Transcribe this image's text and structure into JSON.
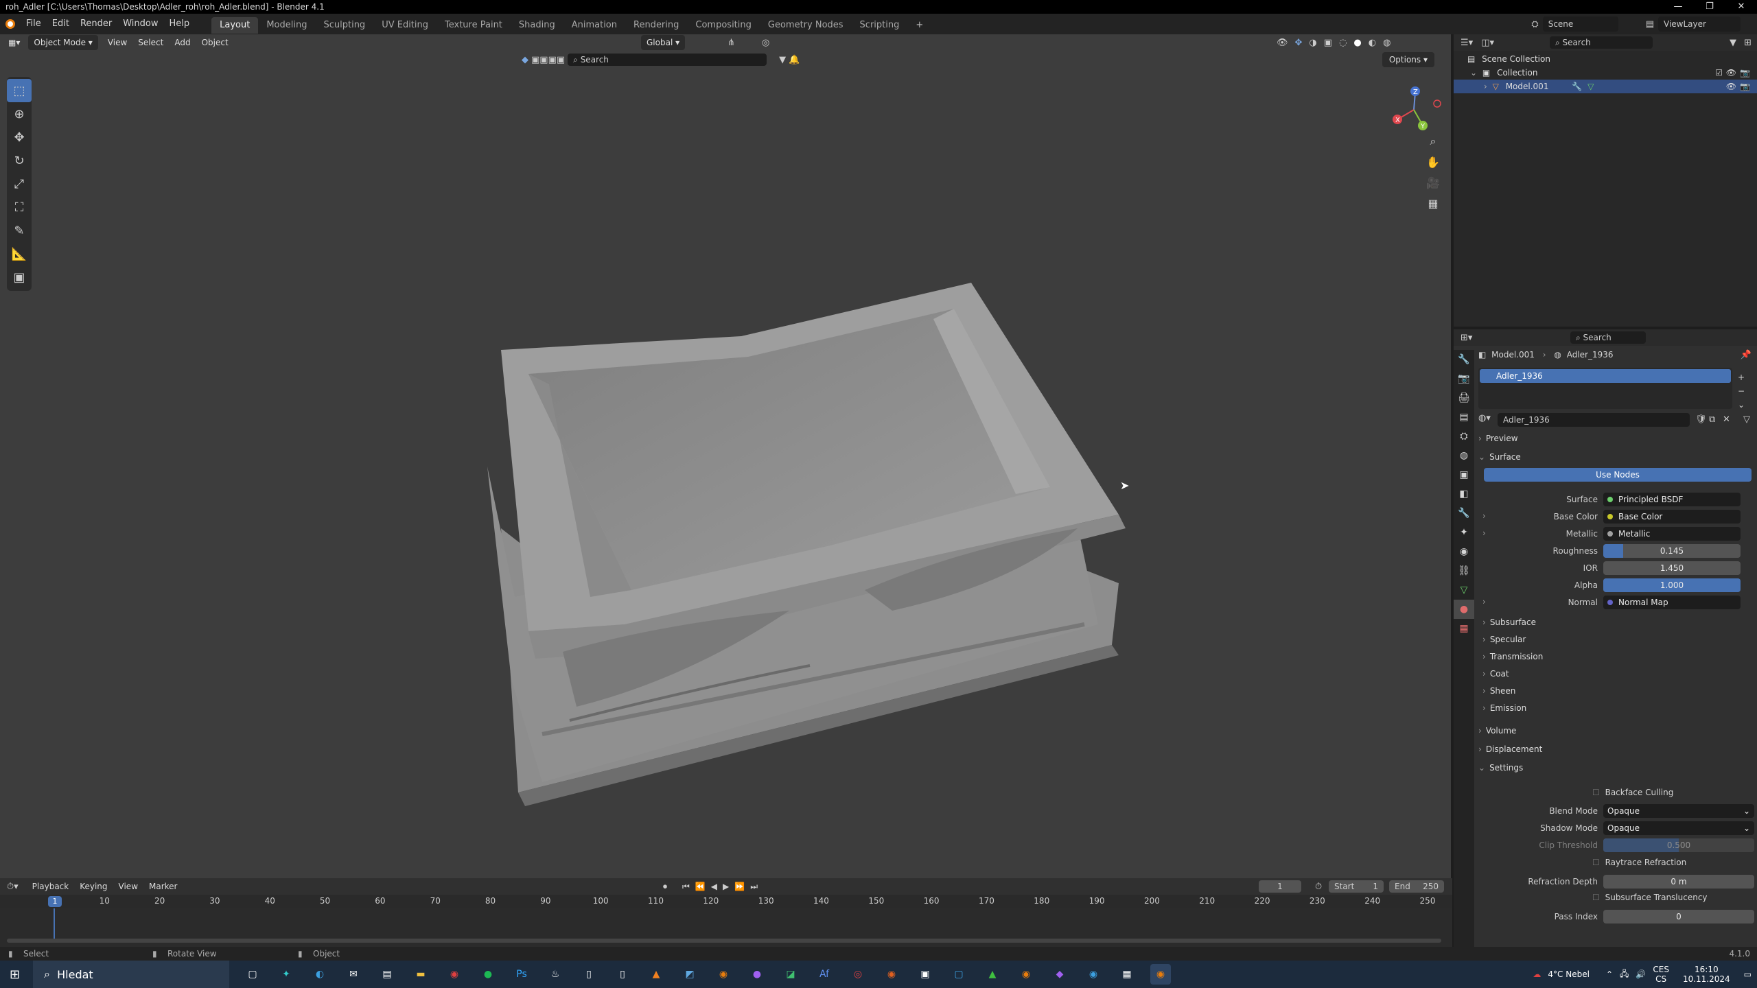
{
  "window": {
    "title": "roh_Adler [C:\\Users\\Thomas\\Desktop\\Adler_roh\\roh_Adler.blend] - Blender 4.1",
    "buttons": [
      "—",
      "❐",
      "✕"
    ]
  },
  "topbar": {
    "menu": [
      "File",
      "Edit",
      "Render",
      "Window",
      "Help"
    ],
    "workspaces": [
      "Layout",
      "Modeling",
      "Sculpting",
      "UV Editing",
      "Texture Paint",
      "Shading",
      "Animation",
      "Rendering",
      "Compositing",
      "Geometry Nodes",
      "Scripting"
    ],
    "active_workspace": "Layout",
    "scene": "Scene",
    "view_layer": "ViewLayer"
  },
  "viewport": {
    "mode": "Object Mode",
    "menu": [
      "View",
      "Select",
      "Add",
      "Object"
    ],
    "transform_orientation": "Global",
    "search_placeholder": "Search",
    "options_label": "Options"
  },
  "timeline": {
    "menu": [
      "Playback",
      "Keying",
      "View",
      "Marker"
    ],
    "current_frame": "1",
    "start_label": "Start",
    "start": "1",
    "end_label": "End",
    "end": "250",
    "ticks": [
      "10",
      "20",
      "30",
      "40",
      "50",
      "60",
      "70",
      "80",
      "90",
      "100",
      "110",
      "120",
      "130",
      "140",
      "150",
      "160",
      "170",
      "180",
      "190",
      "200",
      "210",
      "220",
      "230",
      "240",
      "250"
    ]
  },
  "statusbar": {
    "select": "Select",
    "rotate": "Rotate View",
    "object": "Object",
    "version": "4.1.0"
  },
  "outliner": {
    "search_placeholder": "Search",
    "items": [
      {
        "label": "Scene Collection"
      },
      {
        "label": "Collection"
      },
      {
        "label": "Model.001"
      }
    ]
  },
  "properties": {
    "search_placeholder": "Search",
    "breadcrumb_object": "Model.001",
    "breadcrumb_material": "Adler_1936",
    "slot": "Adler_1936",
    "material_name": "Adler_1936",
    "sections": {
      "preview": "Preview",
      "surface": "Surface",
      "use_nodes": "Use Nodes",
      "volume": "Volume",
      "displacement": "Displacement",
      "settings": "Settings"
    },
    "surface_rows": [
      {
        "label": "Surface",
        "value": "Principled BSDF"
      },
      {
        "label": "Base Color",
        "value": "Base Color"
      },
      {
        "label": "Metallic",
        "value": "Metallic"
      },
      {
        "label": "Roughness",
        "value": "0.145",
        "fill": 0.145
      },
      {
        "label": "IOR",
        "value": "1.450",
        "fill": 0
      },
      {
        "label": "Alpha",
        "value": "1.000",
        "fill": 1.0
      },
      {
        "label": "Normal",
        "value": "Normal Map"
      }
    ],
    "subsections": [
      "Subsurface",
      "Specular",
      "Transmission",
      "Coat",
      "Sheen",
      "Emission"
    ],
    "settings_rows": {
      "backface_culling": "Backface Culling",
      "blend_mode_label": "Blend Mode",
      "blend_mode": "Opaque",
      "shadow_mode_label": "Shadow Mode",
      "shadow_mode": "Opaque",
      "clip_threshold_label": "Clip Threshold",
      "clip_threshold": "0.500",
      "raytrace_refraction": "Raytrace Refraction",
      "refraction_depth_label": "Refraction Depth",
      "refraction_depth": "0 m",
      "subsurface_translucency": "Subsurface Translucency",
      "pass_index_label": "Pass Index",
      "pass_index": "0"
    }
  },
  "taskbar": {
    "search_placeholder": "Hledat",
    "weather": "4°C  Nebel",
    "lang": "CES",
    "lang2": "CS",
    "time": "16:10",
    "date": "10.11.2024"
  },
  "colors": {
    "accent": "#4772b3",
    "selected_row": "#334d80",
    "viewport_bg": "#3d3d3d",
    "model_gray": "#9a9a9a"
  }
}
